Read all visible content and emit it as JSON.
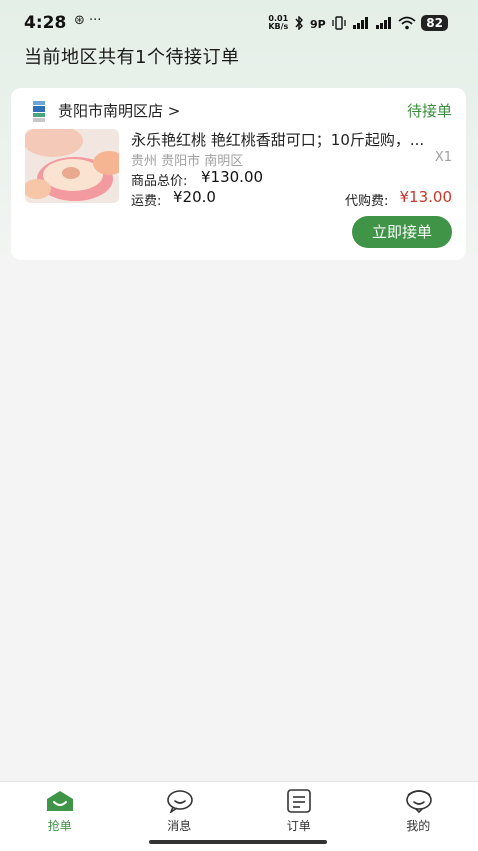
{
  "status_bar": {
    "time": "4:28",
    "left_icons": "⊛ ···",
    "net_speed_value": "0.01",
    "net_speed_unit": "KB/s",
    "battery": "82"
  },
  "page_title": "当前地区共有1个待接订单",
  "orders": [
    {
      "shop_name": "贵阳市南明区店 >",
      "status": "待接单",
      "product_name": "永乐艳红桃 艳红桃香甜可口；10斤起购，...",
      "location": "贵州 贵阳市 南明区",
      "quantity": "X1",
      "total_label": "商品总价:",
      "total_value": "¥130.00",
      "shipping_label": "运费:",
      "shipping_value": "¥20.0",
      "fee_label": "代购费:",
      "fee_value": "¥13.00",
      "accept_label": "立即接单"
    }
  ],
  "tabs": [
    {
      "label": "抢单",
      "icon": "grab-order-icon",
      "active": true
    },
    {
      "label": "消息",
      "icon": "message-icon",
      "active": false
    },
    {
      "label": "订单",
      "icon": "orders-icon",
      "active": false
    },
    {
      "label": "我的",
      "icon": "profile-icon",
      "active": false
    }
  ],
  "colors": {
    "accent": "#3f9447",
    "price_red": "#c9372c",
    "muted": "#a0a0a0"
  }
}
